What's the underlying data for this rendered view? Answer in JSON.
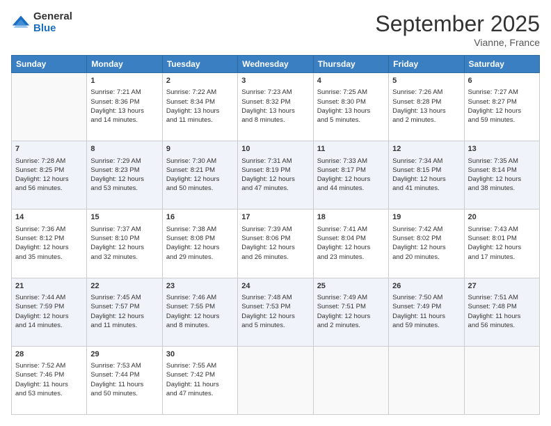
{
  "logo": {
    "line1": "General",
    "line2": "Blue"
  },
  "header": {
    "month": "September 2025",
    "location": "Vianne, France"
  },
  "days": [
    "Sunday",
    "Monday",
    "Tuesday",
    "Wednesday",
    "Thursday",
    "Friday",
    "Saturday"
  ],
  "weeks": [
    [
      {
        "day": "",
        "text": ""
      },
      {
        "day": "1",
        "text": "Sunrise: 7:21 AM\nSunset: 8:36 PM\nDaylight: 13 hours\nand 14 minutes."
      },
      {
        "day": "2",
        "text": "Sunrise: 7:22 AM\nSunset: 8:34 PM\nDaylight: 13 hours\nand 11 minutes."
      },
      {
        "day": "3",
        "text": "Sunrise: 7:23 AM\nSunset: 8:32 PM\nDaylight: 13 hours\nand 8 minutes."
      },
      {
        "day": "4",
        "text": "Sunrise: 7:25 AM\nSunset: 8:30 PM\nDaylight: 13 hours\nand 5 minutes."
      },
      {
        "day": "5",
        "text": "Sunrise: 7:26 AM\nSunset: 8:28 PM\nDaylight: 13 hours\nand 2 minutes."
      },
      {
        "day": "6",
        "text": "Sunrise: 7:27 AM\nSunset: 8:27 PM\nDaylight: 12 hours\nand 59 minutes."
      }
    ],
    [
      {
        "day": "7",
        "text": "Sunrise: 7:28 AM\nSunset: 8:25 PM\nDaylight: 12 hours\nand 56 minutes."
      },
      {
        "day": "8",
        "text": "Sunrise: 7:29 AM\nSunset: 8:23 PM\nDaylight: 12 hours\nand 53 minutes."
      },
      {
        "day": "9",
        "text": "Sunrise: 7:30 AM\nSunset: 8:21 PM\nDaylight: 12 hours\nand 50 minutes."
      },
      {
        "day": "10",
        "text": "Sunrise: 7:31 AM\nSunset: 8:19 PM\nDaylight: 12 hours\nand 47 minutes."
      },
      {
        "day": "11",
        "text": "Sunrise: 7:33 AM\nSunset: 8:17 PM\nDaylight: 12 hours\nand 44 minutes."
      },
      {
        "day": "12",
        "text": "Sunrise: 7:34 AM\nSunset: 8:15 PM\nDaylight: 12 hours\nand 41 minutes."
      },
      {
        "day": "13",
        "text": "Sunrise: 7:35 AM\nSunset: 8:14 PM\nDaylight: 12 hours\nand 38 minutes."
      }
    ],
    [
      {
        "day": "14",
        "text": "Sunrise: 7:36 AM\nSunset: 8:12 PM\nDaylight: 12 hours\nand 35 minutes."
      },
      {
        "day": "15",
        "text": "Sunrise: 7:37 AM\nSunset: 8:10 PM\nDaylight: 12 hours\nand 32 minutes."
      },
      {
        "day": "16",
        "text": "Sunrise: 7:38 AM\nSunset: 8:08 PM\nDaylight: 12 hours\nand 29 minutes."
      },
      {
        "day": "17",
        "text": "Sunrise: 7:39 AM\nSunset: 8:06 PM\nDaylight: 12 hours\nand 26 minutes."
      },
      {
        "day": "18",
        "text": "Sunrise: 7:41 AM\nSunset: 8:04 PM\nDaylight: 12 hours\nand 23 minutes."
      },
      {
        "day": "19",
        "text": "Sunrise: 7:42 AM\nSunset: 8:02 PM\nDaylight: 12 hours\nand 20 minutes."
      },
      {
        "day": "20",
        "text": "Sunrise: 7:43 AM\nSunset: 8:01 PM\nDaylight: 12 hours\nand 17 minutes."
      }
    ],
    [
      {
        "day": "21",
        "text": "Sunrise: 7:44 AM\nSunset: 7:59 PM\nDaylight: 12 hours\nand 14 minutes."
      },
      {
        "day": "22",
        "text": "Sunrise: 7:45 AM\nSunset: 7:57 PM\nDaylight: 12 hours\nand 11 minutes."
      },
      {
        "day": "23",
        "text": "Sunrise: 7:46 AM\nSunset: 7:55 PM\nDaylight: 12 hours\nand 8 minutes."
      },
      {
        "day": "24",
        "text": "Sunrise: 7:48 AM\nSunset: 7:53 PM\nDaylight: 12 hours\nand 5 minutes."
      },
      {
        "day": "25",
        "text": "Sunrise: 7:49 AM\nSunset: 7:51 PM\nDaylight: 12 hours\nand 2 minutes."
      },
      {
        "day": "26",
        "text": "Sunrise: 7:50 AM\nSunset: 7:49 PM\nDaylight: 11 hours\nand 59 minutes."
      },
      {
        "day": "27",
        "text": "Sunrise: 7:51 AM\nSunset: 7:48 PM\nDaylight: 11 hours\nand 56 minutes."
      }
    ],
    [
      {
        "day": "28",
        "text": "Sunrise: 7:52 AM\nSunset: 7:46 PM\nDaylight: 11 hours\nand 53 minutes."
      },
      {
        "day": "29",
        "text": "Sunrise: 7:53 AM\nSunset: 7:44 PM\nDaylight: 11 hours\nand 50 minutes."
      },
      {
        "day": "30",
        "text": "Sunrise: 7:55 AM\nSunset: 7:42 PM\nDaylight: 11 hours\nand 47 minutes."
      },
      {
        "day": "",
        "text": ""
      },
      {
        "day": "",
        "text": ""
      },
      {
        "day": "",
        "text": ""
      },
      {
        "day": "",
        "text": ""
      }
    ]
  ]
}
